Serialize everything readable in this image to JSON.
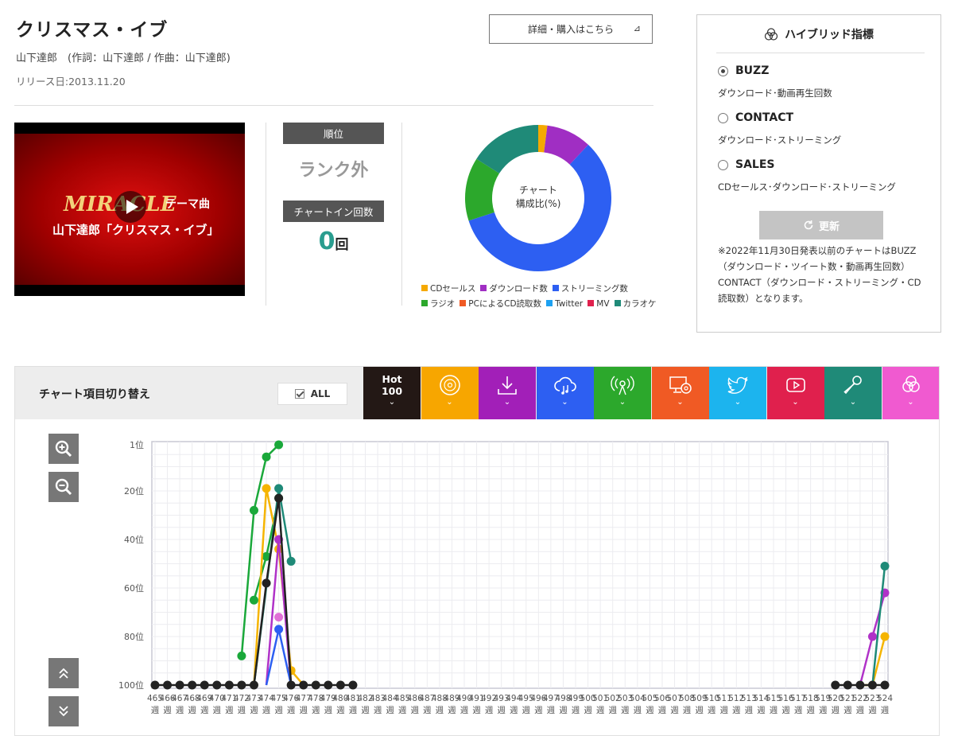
{
  "song": {
    "title": "クリスマス・イブ",
    "artist_line": "山下達郎　(作詞：山下達郎 / 作曲：山下達郎)",
    "release_date": "リリース日:2013.11.20",
    "detail_button": "詳細・購入はこちら",
    "detail_arrow": "⊿"
  },
  "video": {
    "line1": "MIRACLE",
    "line2": "テーマ曲",
    "line3": "山下達郎「クリスマス・イブ」"
  },
  "rank": {
    "label": "順位",
    "value": "ランク外",
    "chartin_label": "チャートイン回数",
    "chartin_count": "0",
    "chartin_unit": "回"
  },
  "composition": {
    "center_line1": "チャート",
    "center_line2": "構成比(%)",
    "legend_row1": [
      {
        "label": "CDセールス",
        "color": "#f5a900"
      },
      {
        "label": "ダウンロード数",
        "color": "#a02ec3"
      },
      {
        "label": "ストリーミング数",
        "color": "#2d5ff2"
      }
    ],
    "legend_row2": [
      {
        "label": "ラジオ",
        "color": "#2ca82c"
      },
      {
        "label": "PCによるCD読取数",
        "color": "#f05a24"
      },
      {
        "label": "Twitter",
        "color": "#1da1f2"
      },
      {
        "label": "MV",
        "color": "#e0204d"
      },
      {
        "label": "カラオケ",
        "color": "#1f8a78"
      }
    ],
    "slices": [
      {
        "name": "CDセールス",
        "value": 2,
        "color": "#f5a900"
      },
      {
        "name": "ダウンロード数",
        "value": 10,
        "color": "#a02ec3"
      },
      {
        "name": "ストリーミング数",
        "value": 58,
        "color": "#2d5ff2"
      },
      {
        "name": "ラジオ",
        "value": 14,
        "color": "#2ca82c"
      },
      {
        "name": "カラオケ",
        "value": 16,
        "color": "#1f8a78"
      }
    ]
  },
  "hybrid": {
    "title": "ハイブリッド指標",
    "options": [
      {
        "label": "BUZZ",
        "desc": "ダウンロード･動画再生回数",
        "selected": true
      },
      {
        "label": "CONTACT",
        "desc": "ダウンロード･ストリーミング",
        "selected": false
      },
      {
        "label": "SALES",
        "desc": "CDセールス･ダウンロード･ストリーミング",
        "selected": false
      }
    ],
    "refresh_label": "更新",
    "note": "※2022年11月30日発表以前のチャートはBUZZ（ダウンロード・ツイート数・動画再生回数）CONTACT（ダウンロード・ストリーミング・CD読取数）となります。"
  },
  "switcher": {
    "label": "チャート項目切り替え",
    "all_label": "ALL",
    "hot_line1": "Hot",
    "hot_line2": "100",
    "chevron": "⌄",
    "tiles": [
      {
        "icon": "hot100",
        "color": "#231815"
      },
      {
        "icon": "cd-icon",
        "color": "#f7a600"
      },
      {
        "icon": "download-icon",
        "color": "#a21fb8"
      },
      {
        "icon": "streaming-icon",
        "color": "#2d5ff2"
      },
      {
        "icon": "radio-icon",
        "color": "#2ca82c"
      },
      {
        "icon": "pc-cd-icon",
        "color": "#f05a24"
      },
      {
        "icon": "twitter-icon",
        "color": "#1cb4ee"
      },
      {
        "icon": "youtube-icon",
        "color": "#e0204d"
      },
      {
        "icon": "karaoke-icon",
        "color": "#1f8a78"
      },
      {
        "icon": "hybrid-icon",
        "color": "#f05ad0"
      }
    ]
  },
  "chart_data": {
    "type": "line",
    "y_tick_labels": [
      "1位",
      "20位",
      "40位",
      "60位",
      "80位",
      "100位"
    ],
    "y_tick_values": [
      1,
      20,
      40,
      60,
      80,
      100
    ],
    "ylim": [
      1,
      100
    ],
    "y_inverted": true,
    "week_labels": [
      "465",
      "466",
      "467",
      "468",
      "469",
      "470",
      "471",
      "472",
      "473",
      "474",
      "475",
      "476",
      "477",
      "478",
      "479",
      "480",
      "481",
      "482",
      "483",
      "484",
      "485",
      "486",
      "487",
      "488",
      "489",
      "490",
      "491",
      "492",
      "493",
      "494",
      "495",
      "496",
      "497",
      "498",
      "499",
      "500",
      "501",
      "502",
      "503",
      "504",
      "505",
      "506",
      "507",
      "508",
      "509",
      "510",
      "511",
      "512",
      "513",
      "514",
      "515",
      "516",
      "517",
      "518",
      "519",
      "520",
      "521",
      "522",
      "523",
      "524"
    ],
    "week_suffix": "週",
    "grid": true,
    "series": [
      {
        "key": "radio",
        "color": "#1aa83a",
        "points": [
          [
            472,
            88
          ],
          [
            473,
            28
          ],
          [
            474,
            6
          ],
          [
            475,
            1
          ]
        ]
      },
      {
        "key": "radio2",
        "color": "#1aa83a",
        "points": [
          [
            473,
            65
          ],
          [
            474,
            47
          ],
          [
            475,
            23
          ]
        ]
      },
      {
        "key": "cd",
        "color": "#f5b400",
        "points": [
          [
            473,
            100
          ],
          [
            474,
            19
          ],
          [
            475,
            44
          ],
          [
            476,
            94
          ],
          [
            477,
            100
          ]
        ],
        "tail": [
          [
            522,
            100
          ],
          [
            523,
            100
          ],
          [
            524,
            80
          ]
        ]
      },
      {
        "key": "download",
        "color": "#b032c8",
        "points": [
          [
            474,
            100
          ],
          [
            475,
            40
          ],
          [
            476,
            100
          ]
        ],
        "tail": [
          [
            522,
            100
          ],
          [
            523,
            80
          ],
          [
            524,
            62
          ]
        ]
      },
      {
        "key": "stream",
        "color": "#2d5ff2",
        "points": [
          [
            474,
            100
          ],
          [
            475,
            77
          ],
          [
            476,
            100
          ]
        ]
      },
      {
        "key": "mv",
        "color": "#e070d6",
        "points": [
          [
            475,
            72
          ]
        ]
      },
      {
        "key": "karaoke",
        "color": "#1f8a78",
        "points": [
          [
            473,
            100
          ],
          [
            475,
            19
          ],
          [
            476,
            49
          ]
        ],
        "tail": [
          [
            523,
            100
          ],
          [
            524,
            51
          ]
        ]
      },
      {
        "key": "hot100",
        "color": "#222222",
        "points": [
          [
            465,
            100
          ],
          [
            466,
            100
          ],
          [
            467,
            100
          ],
          [
            468,
            100
          ],
          [
            469,
            100
          ],
          [
            470,
            100
          ],
          [
            471,
            100
          ],
          [
            472,
            100
          ],
          [
            473,
            100
          ],
          [
            474,
            58
          ],
          [
            475,
            23
          ],
          [
            476,
            100
          ],
          [
            477,
            100
          ],
          [
            478,
            100
          ],
          [
            479,
            100
          ],
          [
            480,
            100
          ],
          [
            481,
            100
          ]
        ],
        "tail": [
          [
            520,
            100
          ],
          [
            521,
            100
          ],
          [
            522,
            100
          ],
          [
            523,
            100
          ],
          [
            524,
            100
          ]
        ]
      }
    ]
  }
}
